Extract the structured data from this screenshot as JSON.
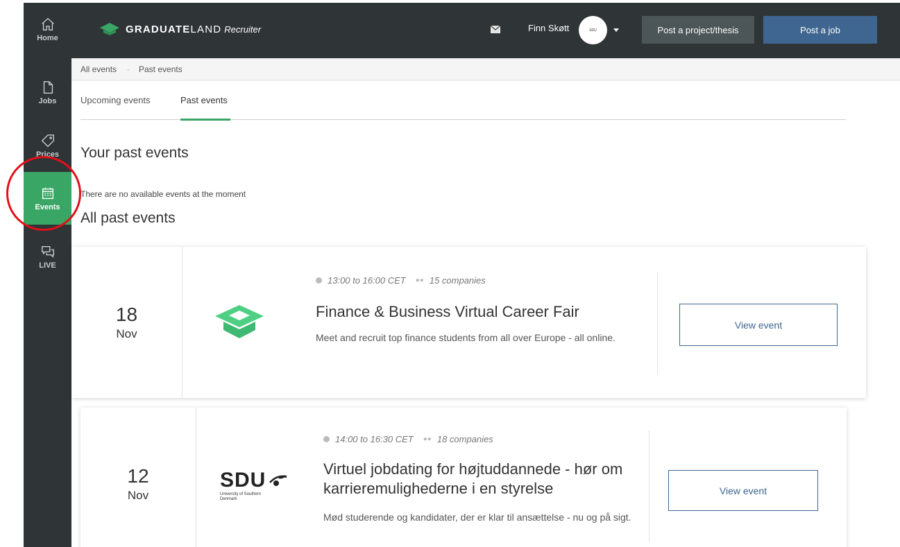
{
  "sidebar": {
    "items": [
      {
        "label": "Home",
        "icon": "home-icon"
      },
      {
        "label": "Jobs",
        "icon": "document-icon"
      },
      {
        "label": "Prices",
        "icon": "tag-icon"
      },
      {
        "label": "Events",
        "icon": "calendar-icon",
        "active": true
      },
      {
        "label": "LIVE",
        "icon": "chat-icon"
      }
    ]
  },
  "header": {
    "brand_bold": "GRADUATE",
    "brand_light": "LAND",
    "brand_suffix": "Recruiter",
    "user_name": "Finn Skøtt",
    "avatar_text": "SDU",
    "post_project_label": "Post a project/thesis",
    "post_job_label": "Post a job"
  },
  "breadcrumb": {
    "items": [
      "All events",
      "Past events"
    ],
    "separator": "-"
  },
  "tabs": [
    {
      "label": "Upcoming events",
      "active": false
    },
    {
      "label": "Past events",
      "active": true
    }
  ],
  "sections": {
    "your_past": "Your past events",
    "empty_message": "There are no available events at the moment",
    "all_past": "All past events"
  },
  "events": [
    {
      "day": "18",
      "month": "Nov",
      "time": "13:00 to 16:00  CET",
      "companies": "15 companies",
      "title": "Finance & Business Virtual Career Fair",
      "description": "Meet and recruit top finance students from all over Europe - all online.",
      "logo": "graduateland-logo",
      "button": "View event"
    },
    {
      "day": "12",
      "month": "Nov",
      "time": "14:00 to 16:30  CET",
      "companies": "18 companies",
      "title": "Virtuel jobdating for højtuddannede - hør om karrieremulighederne i en styrelse",
      "description": "Mød studerende og kandidater, der er klar til ansættelse - nu og på sigt.",
      "logo_text": "SDU",
      "logo_sub": "University of Southern Denmark",
      "button": "View event"
    }
  ],
  "colors": {
    "sidebar_bg": "#2f3436",
    "accent_green": "#3aa665",
    "button_blue": "#3f6690",
    "annotation_red": "#e0101a"
  }
}
